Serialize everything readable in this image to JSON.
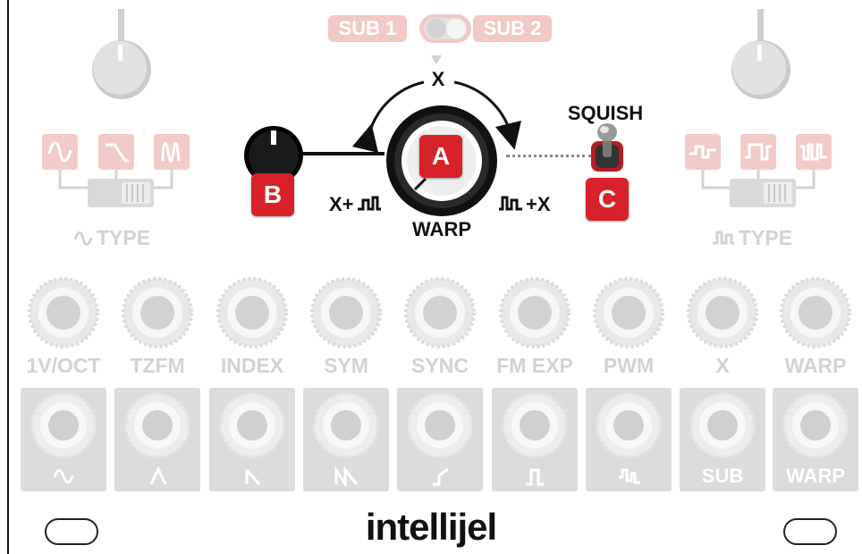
{
  "switch": {
    "sub1_label": "SUB 1",
    "sub2_label": "SUB 2"
  },
  "warp_section": {
    "x_label": "X",
    "warp_label": "WARP",
    "squish_label": "SQUISH",
    "left_range_prefix": "X+",
    "right_range_suffix": "+X",
    "badges": {
      "a": "A",
      "b": "B",
      "c": "C"
    }
  },
  "type_left": {
    "label": "TYPE"
  },
  "type_right": {
    "label": "TYPE"
  },
  "input_jacks": [
    "1V/OCT",
    "TZFM",
    "INDEX",
    "SYM",
    "SYNC",
    "FM EXP",
    "PWM",
    "X",
    "WARP"
  ],
  "output_labels": {
    "sub": "SUB",
    "warp": "WARP"
  },
  "brand": "intellijel",
  "colors": {
    "accent_red": "#d8222a",
    "faded_red": "#f2cbc8",
    "faded_gray": "#d3d3d3"
  }
}
